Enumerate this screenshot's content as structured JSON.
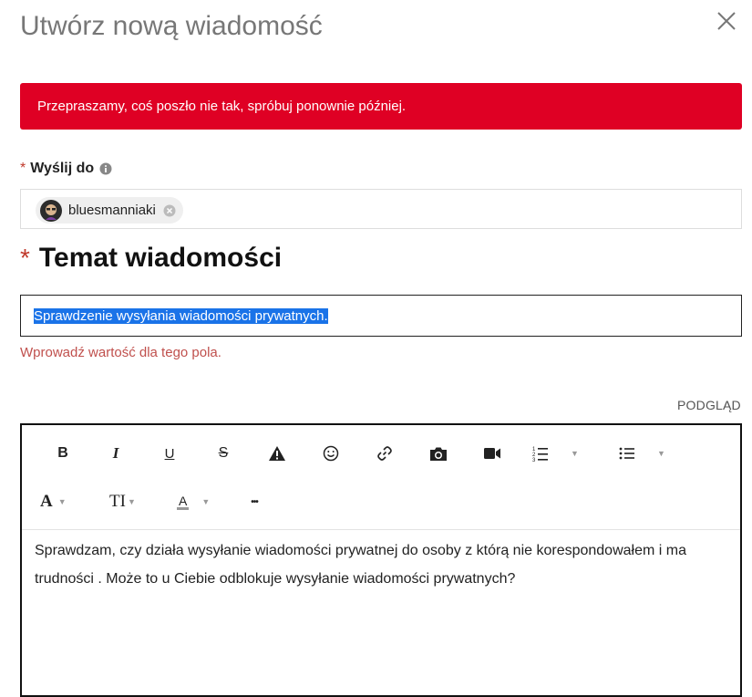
{
  "dialog": {
    "title": "Utwórz nową wiadomość"
  },
  "error": {
    "message": "Przepraszamy, coś poszło nie tak, spróbuj ponownie później."
  },
  "recipients": {
    "label": "Wyślij do",
    "required_marker": "*",
    "chips": [
      {
        "username": "bluesmanniaki"
      }
    ]
  },
  "subject": {
    "heading": "Temat wiadomości",
    "required_marker": "*",
    "value": "Sprawdzenie wysyłania wiadomości prywatnych.",
    "validation": "Wprowadź wartość dla tego pola."
  },
  "editor": {
    "preview_label": "PODGLĄD",
    "toolbar": {
      "row1": [
        "bold-icon",
        "italic-icon",
        "underline-icon",
        "strikethrough-icon",
        "warning-icon",
        "emoji-icon",
        "link-icon",
        "camera-icon",
        "video-icon",
        "numbered-list-icon",
        "bullet-list-icon"
      ],
      "row2": [
        "font-family-icon",
        "text-size-icon",
        "text-color-icon",
        "more-icon"
      ],
      "bold_glyph": "B",
      "italic_glyph": "I",
      "underline_glyph": "U",
      "strike_glyph": "S",
      "font_glyph": "A",
      "size_glyph": "TI",
      "color_glyph": "A",
      "more_glyph": "•••"
    },
    "body": "Sprawdzam, czy działa wysyłanie wiadomości prywatnej do osoby z którą nie korespondowałem i ma trudności . Może to u Ciebie odblokuje wysyłanie wiadomości prywatnych?"
  },
  "colors": {
    "error_bg": "#df0024",
    "required": "#c0392b",
    "validation": "#c0504d",
    "selection": "#1a73e8"
  }
}
